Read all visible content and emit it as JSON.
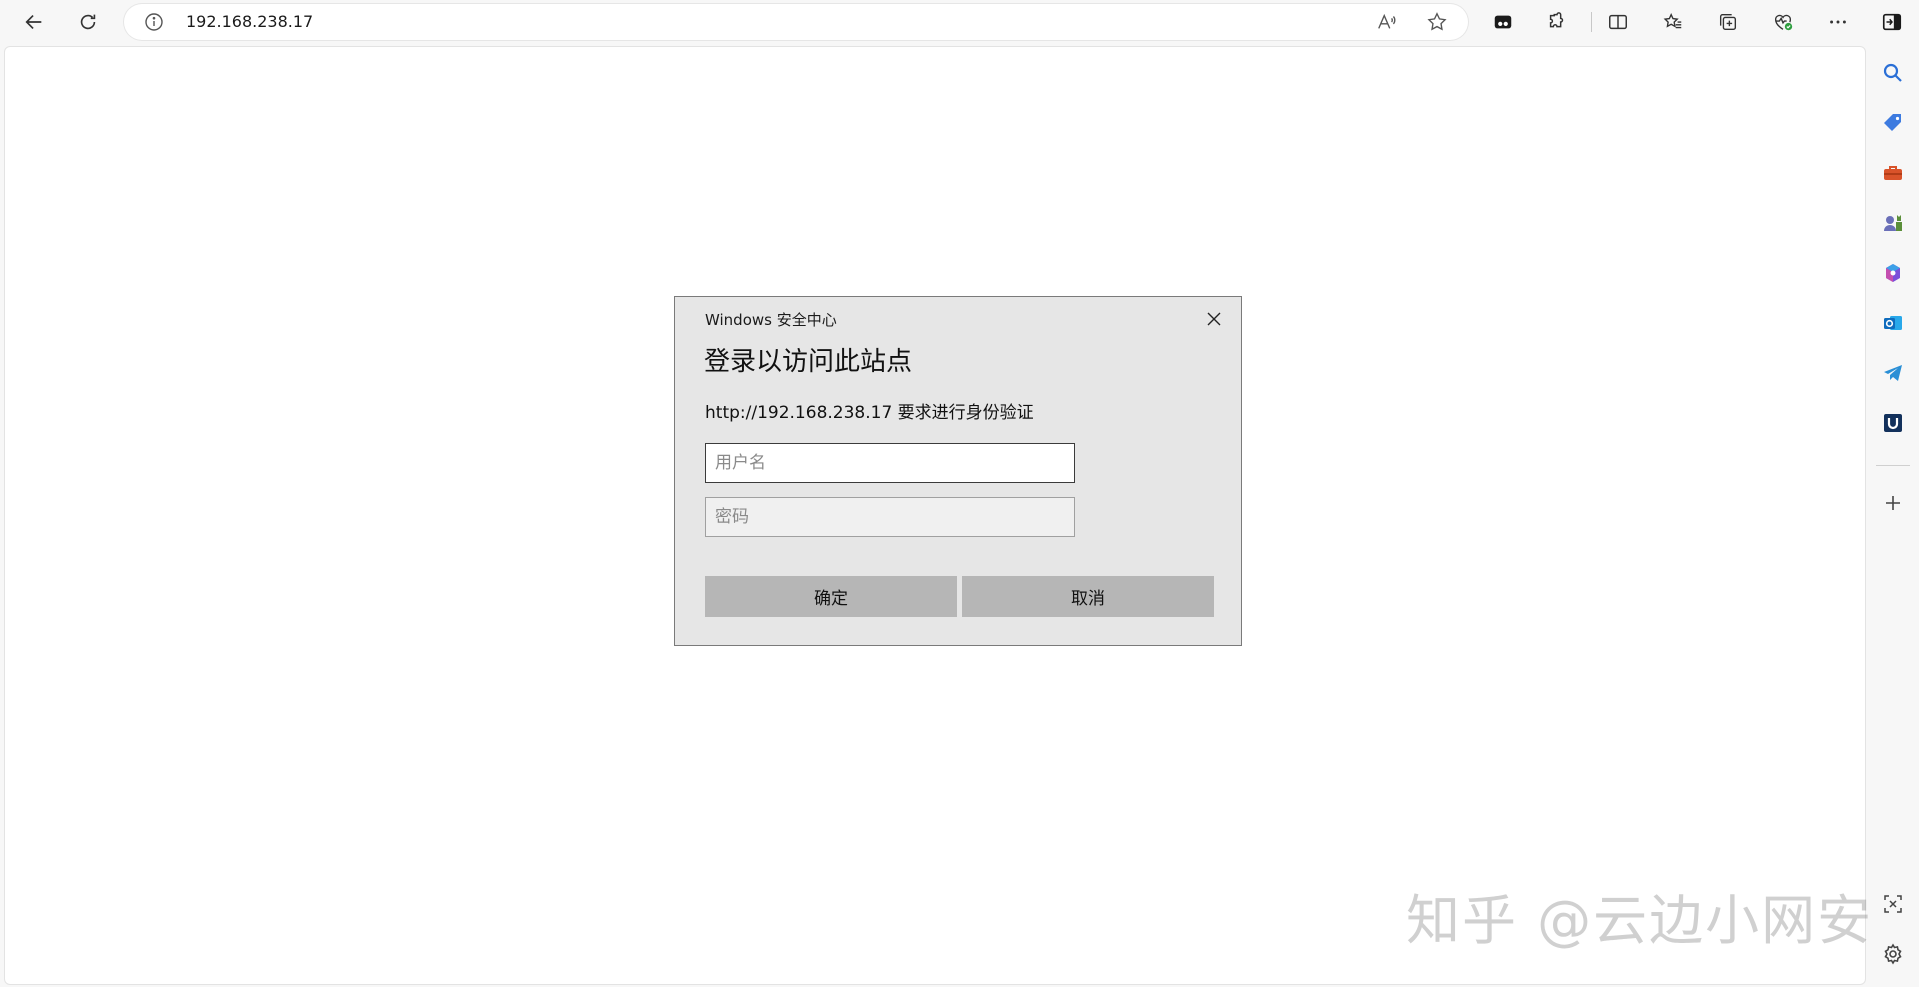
{
  "browser": {
    "url": "192.168.238.17",
    "toolbar_icons": [
      "back-icon",
      "refresh-icon",
      "info-icon",
      "read-aloud-icon",
      "favorite-star-icon",
      "tab-actions-icon",
      "extensions-icon",
      "split-screen-icon",
      "favorites-icon",
      "collections-icon",
      "browser-essentials-icon",
      "more-icon",
      "sidebar-toggle-icon"
    ],
    "sidebar_icons": [
      "search-icon",
      "shopping-tag-icon",
      "tools-briefcase-icon",
      "games-icon",
      "copilot-icon",
      "outlook-icon",
      "telegram-icon",
      "u-app-icon",
      "add-icon",
      "screenshot-icon",
      "settings-icon"
    ]
  },
  "dialog": {
    "title": "Windows 安全中心",
    "heading": "登录以访问此站点",
    "message": "http://192.168.238.17 要求进行身份验证",
    "username_placeholder": "用户名",
    "password_placeholder": "密码",
    "ok_label": "确定",
    "cancel_label": "取消"
  },
  "watermark": {
    "text": "知乎 @云边小网安"
  },
  "colors": {
    "dialog_bg": "#e6e6e6",
    "button_bg": "#b6b6b6",
    "chrome_bg": "#f7f7f7"
  }
}
